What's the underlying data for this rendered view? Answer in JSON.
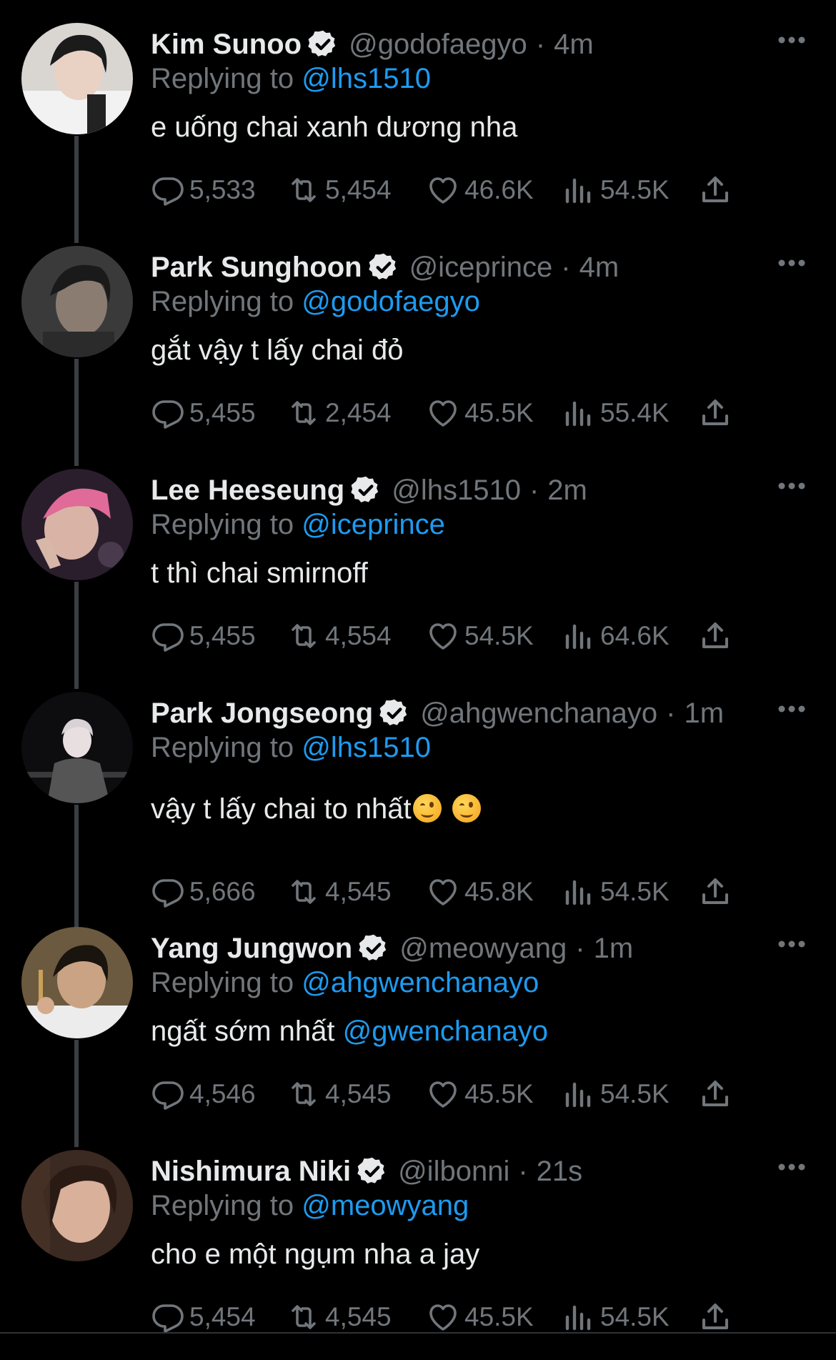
{
  "replying_prefix": "Replying to ",
  "tweets": [
    {
      "name": "Kim Sunoo",
      "handle": "@godofaegyo",
      "separator": "·",
      "time": "4m",
      "replying_to": "@lhs1510",
      "text": "e uống chai xanh dương nha",
      "replies": "5,533",
      "retweets": "5,454",
      "likes": "46.6K",
      "views": "54.5K"
    },
    {
      "name": "Park Sunghoon",
      "handle": "@iceprince",
      "separator": "·",
      "time": "4m",
      "replying_to": "@godofaegyo",
      "text": "gắt vậy t lấy chai đỏ",
      "replies": "5,455",
      "retweets": "2,454",
      "likes": "45.5K",
      "views": "55.4K"
    },
    {
      "name": "Lee Heeseung",
      "handle": "@lhs1510",
      "separator": "·",
      "time": "2m",
      "replying_to": "@iceprince",
      "text": "t thì chai smirnoff",
      "replies": "5,455",
      "retweets": "4,554",
      "likes": "54.5K",
      "views": "64.6K"
    },
    {
      "name": "Park Jongseong",
      "handle": "@ahgwenchanayo",
      "separator": "·",
      "time": "1m",
      "replying_to": "@lhs1510",
      "text": "vậy t lấy chai to nhất",
      "replies": "5,666",
      "retweets": "4,545",
      "likes": "45.8K",
      "views": "54.5K"
    },
    {
      "name": "Yang Jungwon",
      "handle": "@meowyang",
      "separator": "·",
      "time": "1m",
      "replying_to": "@ahgwenchanayo",
      "text": "ngất sớm nhất ",
      "text_mention": "@gwenchanayo",
      "replies": "4,546",
      "retweets": "4,545",
      "likes": "45.5K",
      "views": "54.5K"
    },
    {
      "name": "Nishimura Niki",
      "handle": "@ilbonni",
      "separator": "·",
      "time": "21s",
      "replying_to": "@meowyang",
      "text": "cho e một ngụm nha a jay",
      "replies": "5,454",
      "retweets": "4,545",
      "likes": "45.5K",
      "views": "54.5K"
    }
  ],
  "colors": {
    "background": "#000000",
    "text_primary": "#e7e9ea",
    "text_secondary": "#71767b",
    "accent_link": "#1d9bf0",
    "thread_line": "#3a3d41"
  }
}
